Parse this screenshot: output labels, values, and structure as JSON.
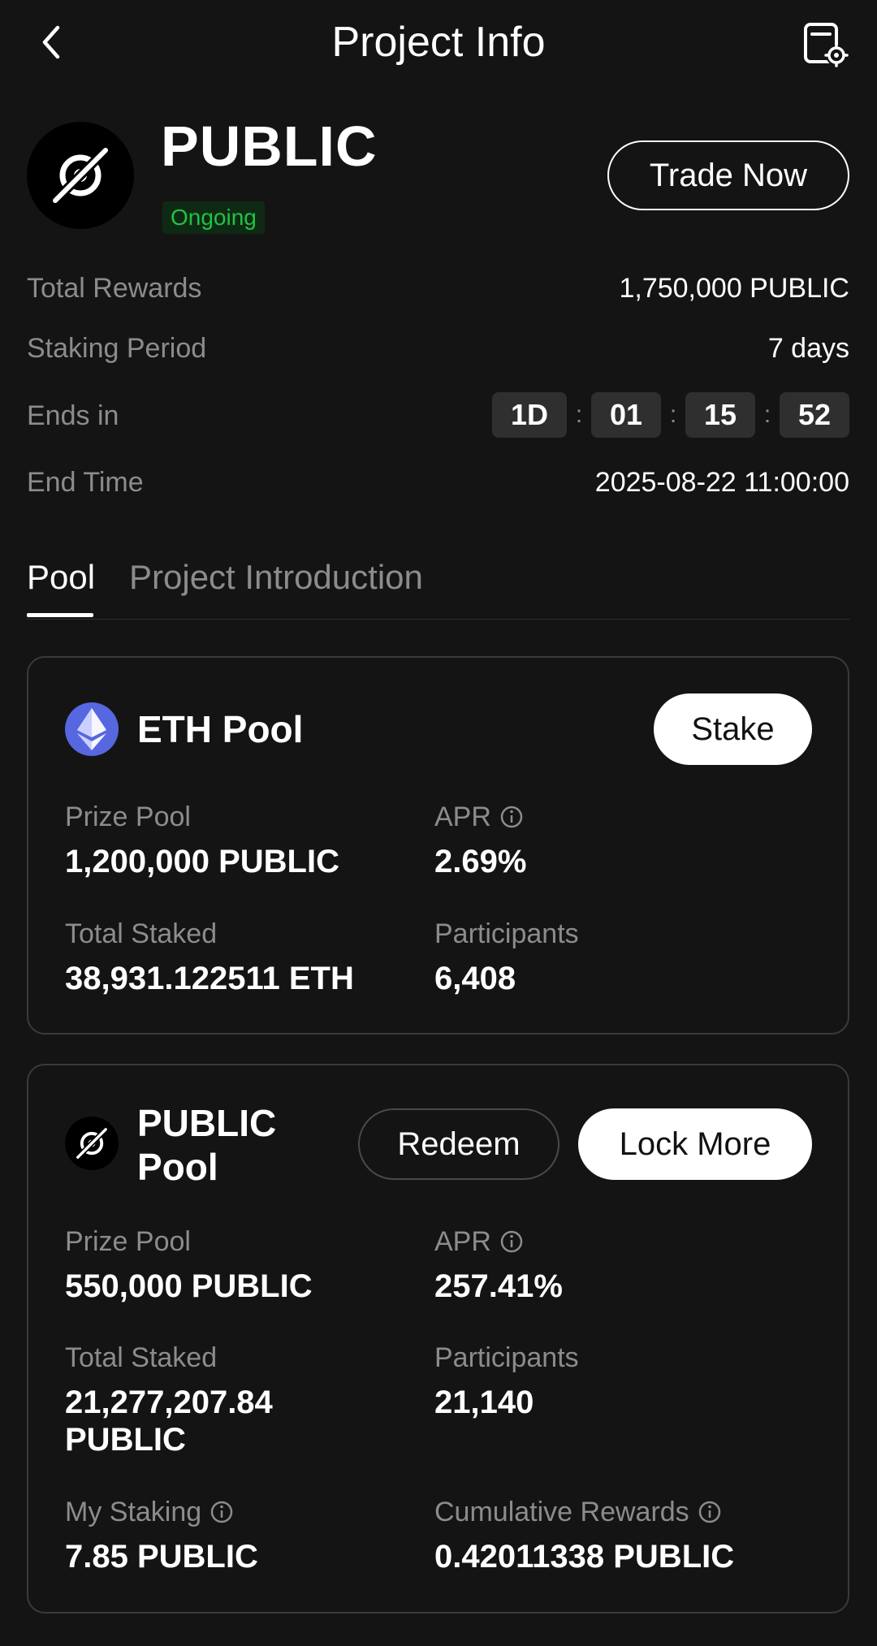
{
  "header": {
    "title": "Project Info",
    "back_icon": "back-arrow-icon",
    "settings_icon": "document-settings-icon"
  },
  "project": {
    "name": "PUBLIC",
    "status": "Ongoing",
    "trade_label": "Trade Now",
    "colors": {
      "status_text": "#23c144",
      "status_bg": "#0f2a14",
      "background": "#141414"
    }
  },
  "info": {
    "total_rewards_label": "Total Rewards",
    "total_rewards_value": "1,750,000 PUBLIC",
    "staking_period_label": "Staking Period",
    "staking_period_value": "7 days",
    "ends_in_label": "Ends in",
    "countdown": {
      "days": "1D",
      "hours": "01",
      "minutes": "15",
      "seconds": "52",
      "separator": ":"
    },
    "end_time_label": "End Time",
    "end_time_value": "2025-08-22 11:00:00"
  },
  "tabs": [
    {
      "label": "Pool",
      "active": true
    },
    {
      "label": "Project Introduction",
      "active": false
    }
  ],
  "eth_pool": {
    "title": "ETH Pool",
    "stake_label": "Stake",
    "prize_pool_label": "Prize Pool",
    "prize_pool_value": "1,200,000 PUBLIC",
    "apr_label": "APR",
    "apr_value": "2.69%",
    "total_staked_label": "Total Staked",
    "total_staked_value": "38,931.122511 ETH",
    "participants_label": "Participants",
    "participants_value": "6,408",
    "icon_color": "#5667e0"
  },
  "public_pool": {
    "title_line1": "PUBLIC",
    "title_line2": "Pool",
    "redeem_label": "Redeem",
    "lock_more_label": "Lock More",
    "prize_pool_label": "Prize Pool",
    "prize_pool_value": "550,000 PUBLIC",
    "apr_label": "APR",
    "apr_value": "257.41%",
    "total_staked_label": "Total Staked",
    "total_staked_line1": "21,277,207.84",
    "total_staked_line2": "PUBLIC",
    "participants_label": "Participants",
    "participants_value": "21,140",
    "my_staking_label": "My Staking",
    "my_staking_value": "7.85 PUBLIC",
    "cumulative_rewards_label": "Cumulative Rewards",
    "cumulative_rewards_value": "0.42011338 PUBLIC"
  }
}
